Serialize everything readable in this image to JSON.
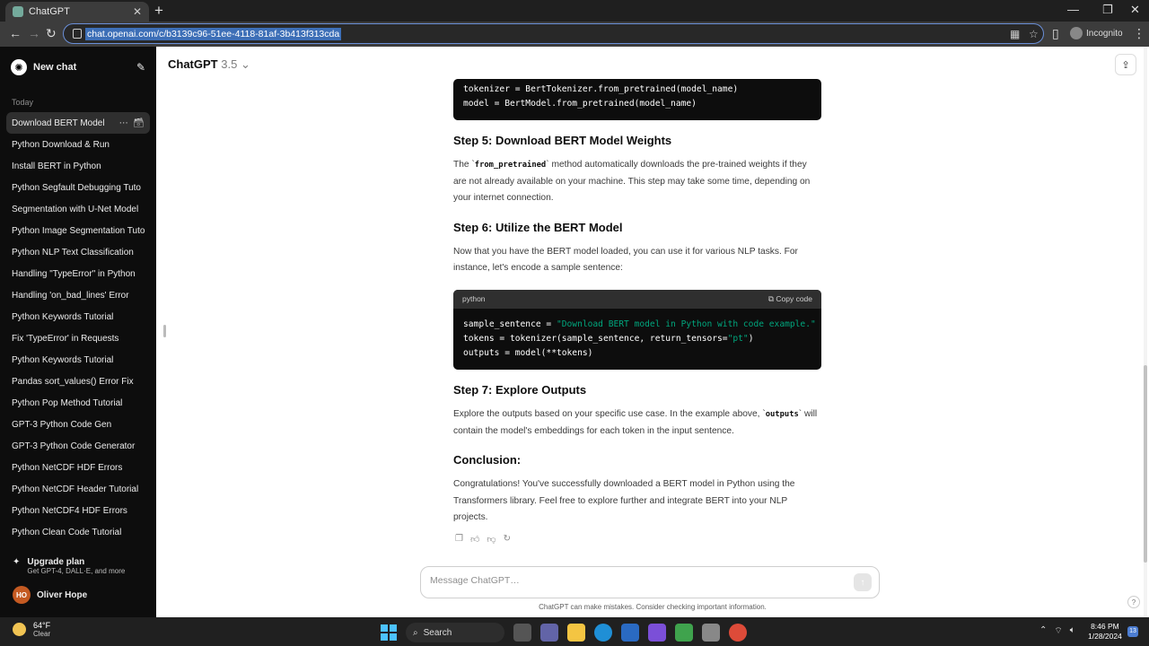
{
  "browser": {
    "tab_title": "ChatGPT",
    "url": "chat.openai.com/c/b3139c96-51ee-4118-81af-3b413f313cda",
    "profile_label": "Incognito"
  },
  "sidebar": {
    "new_chat_label": "New chat",
    "section_label": "Today",
    "items": [
      {
        "label": "Download BERT Model"
      },
      {
        "label": "Python Download & Run"
      },
      {
        "label": "Install BERT in Python"
      },
      {
        "label": "Python Segfault Debugging Tuto"
      },
      {
        "label": "Segmentation with U-Net Model"
      },
      {
        "label": "Python Image Segmentation Tuto"
      },
      {
        "label": "Python NLP Text Classification"
      },
      {
        "label": "Handling \"TypeError\" in Python"
      },
      {
        "label": "Handling 'on_bad_lines' Error"
      },
      {
        "label": "Python Keywords Tutorial"
      },
      {
        "label": "Fix 'TypeError' in Requests"
      },
      {
        "label": "Python Keywords Tutorial"
      },
      {
        "label": "Pandas sort_values() Error Fix"
      },
      {
        "label": "Python Pop Method Tutorial"
      },
      {
        "label": "GPT-3 Python Code Gen"
      },
      {
        "label": "GPT-3 Python Code Generator"
      },
      {
        "label": "Python NetCDF HDF Errors"
      },
      {
        "label": "Python NetCDF Header Tutorial"
      },
      {
        "label": "Python NetCDF4 HDF Errors"
      },
      {
        "label": "Python Clean Code Tutorial"
      }
    ],
    "upgrade_title": "Upgrade plan",
    "upgrade_subtitle": "Get GPT-4, DALL·E, and more",
    "user_initials": "HO",
    "user_name": "Oliver Hope"
  },
  "header": {
    "model_name": "ChatGPT",
    "model_version": "3.5"
  },
  "conversation": {
    "code1_line1": "tokenizer = BertTokenizer.from_pretrained(model_name)",
    "code1_line2": "model = BertModel.from_pretrained(model_name)",
    "step5_heading": "Step 5: Download BERT Model Weights",
    "step5_pre": "The `",
    "step5_code": "from_pretrained",
    "step5_post": "` method automatically downloads the pre-trained weights if they are not already available on your machine. This step may take some time, depending on your internet connection.",
    "step6_heading": "Step 6: Utilize the BERT Model",
    "step6_text": "Now that you have the BERT model loaded, you can use it for various NLP tasks. For instance, let's encode a sample sentence:",
    "code2_lang": "python",
    "code2_copy": "Copy code",
    "code2_line1_a": "sample_sentence = ",
    "code2_line1_b": "\"Download BERT model in Python with code example.\"",
    "code2_line2_a": "tokens = tokenizer(sample_sentence, return_tensors=",
    "code2_line2_b": "\"pt\"",
    "code2_line2_c": ")",
    "code2_line3": "outputs = model(**tokens)",
    "step7_heading": "Step 7: Explore Outputs",
    "step7_pre": "Explore the outputs based on your specific use case. In the example above, `",
    "step7_code": "outputs",
    "step7_post": "` will contain the model's embeddings for each token in the input sentence.",
    "conclusion_heading": "Conclusion:",
    "conclusion_text": "Congratulations! You've successfully downloaded a BERT model in Python using the Transformers library. Feel free to explore further and integrate BERT into your NLP projects."
  },
  "composer": {
    "placeholder": "Message ChatGPT…",
    "disclaimer": "ChatGPT can make mistakes. Consider checking important information."
  },
  "taskbar": {
    "temperature": "64°F",
    "condition": "Clear",
    "search_label": "Search",
    "time": "8:46 PM",
    "date": "1/28/2024",
    "notification_count": "13"
  }
}
